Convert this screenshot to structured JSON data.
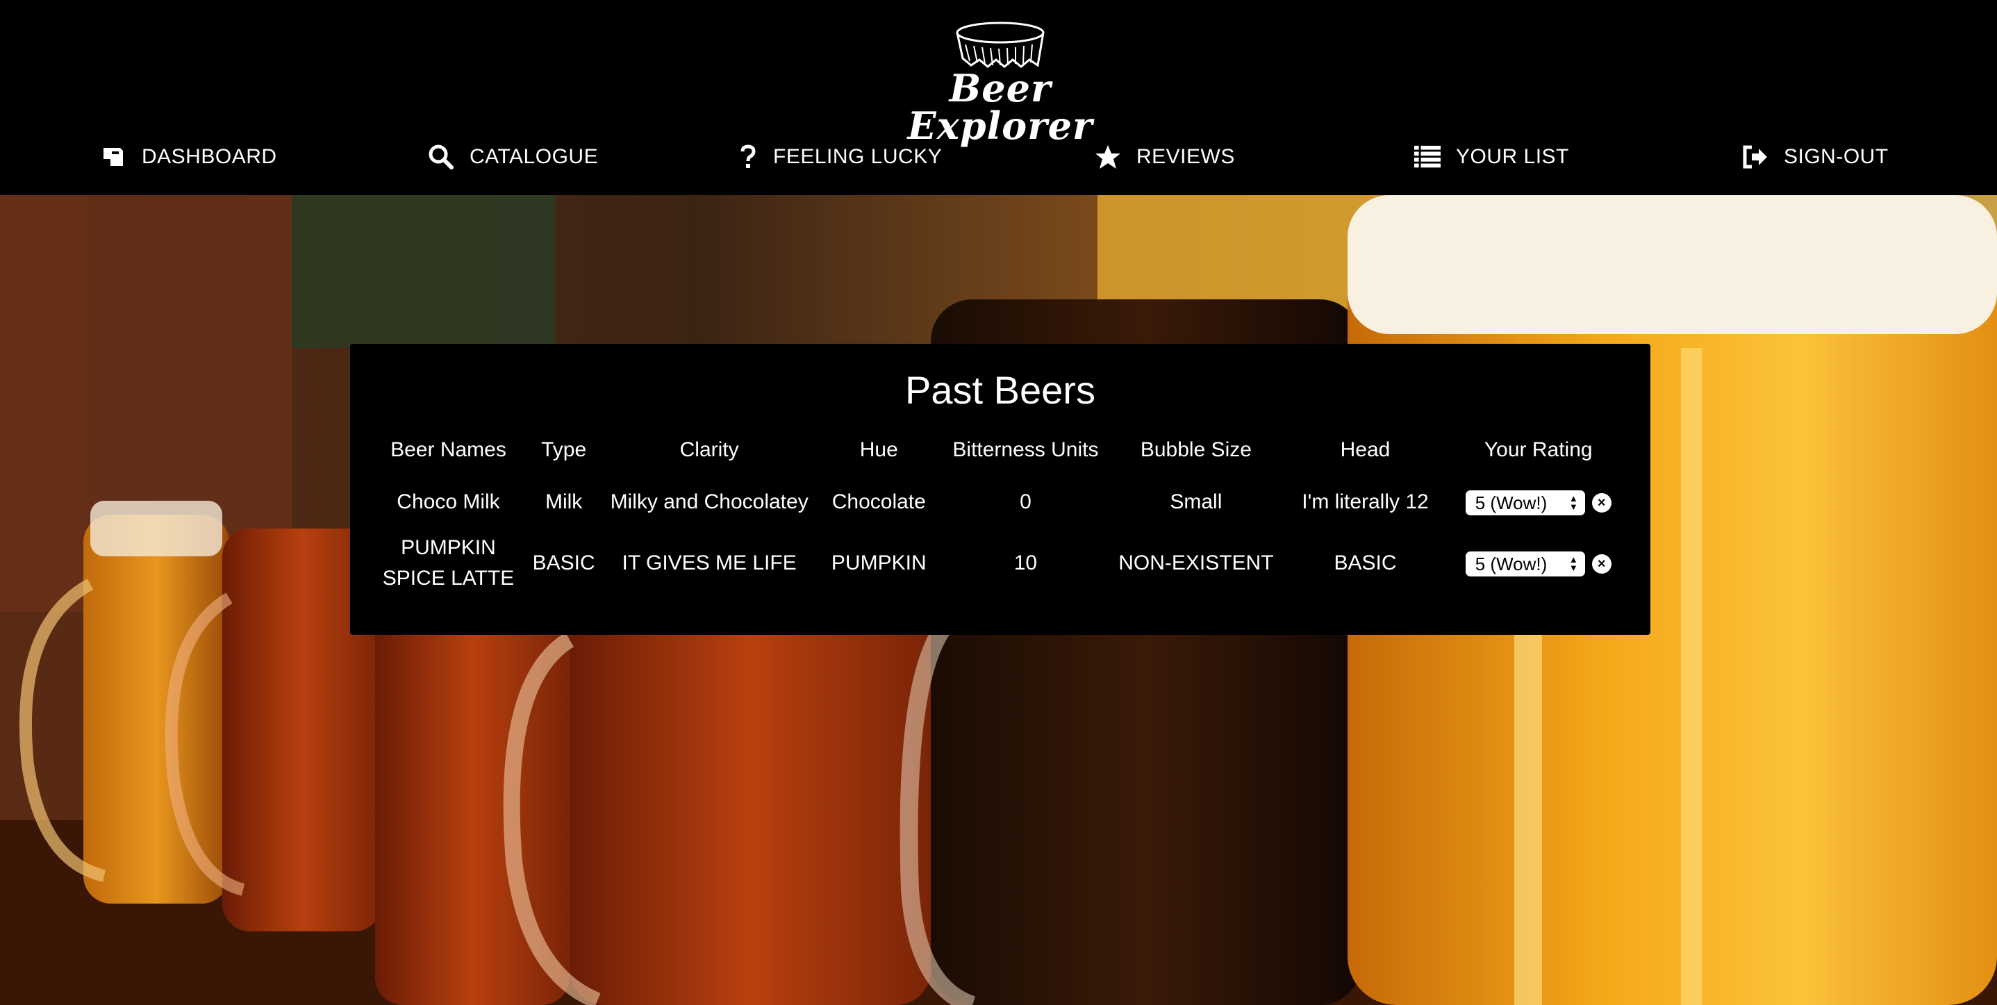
{
  "app": {
    "brand": "Beer Explorer"
  },
  "nav": [
    {
      "label": "DASHBOARD",
      "icon": "dashboard-icon"
    },
    {
      "label": "CATALOGUE",
      "icon": "search-icon"
    },
    {
      "label": "FEELING LUCKY",
      "icon": "question-icon"
    },
    {
      "label": "REVIEWS",
      "icon": "star-icon"
    },
    {
      "label": "YOUR LIST",
      "icon": "list-icon"
    },
    {
      "label": "SIGN-OUT",
      "icon": "sign-out-icon"
    }
  ],
  "panel": {
    "title": "Past Beers",
    "columns": [
      "Beer Names",
      "Type",
      "Clarity",
      "Hue",
      "Bitterness Units",
      "Bubble Size",
      "Head",
      "Your Rating"
    ],
    "rows": [
      {
        "name": "Choco Milk",
        "type": "Milk",
        "clarity": "Milky and Chocolatey",
        "hue": "Chocolate",
        "bitterness": "0",
        "bubble_size": "Small",
        "head": "I'm literally 12",
        "rating": "5 (Wow!)"
      },
      {
        "name": "PUMPKIN SPICE LATTE",
        "type": "BASIC",
        "clarity": "IT GIVES ME LIFE",
        "hue": "PUMPKIN",
        "bitterness": "10",
        "bubble_size": "NON-EXISTENT",
        "head": "BASIC",
        "rating": "5 (Wow!)"
      }
    ]
  },
  "colors": {
    "header_bg": "#000000",
    "panel_bg": "#000000",
    "text": "#ffffff",
    "amber": "#f3a31b"
  }
}
